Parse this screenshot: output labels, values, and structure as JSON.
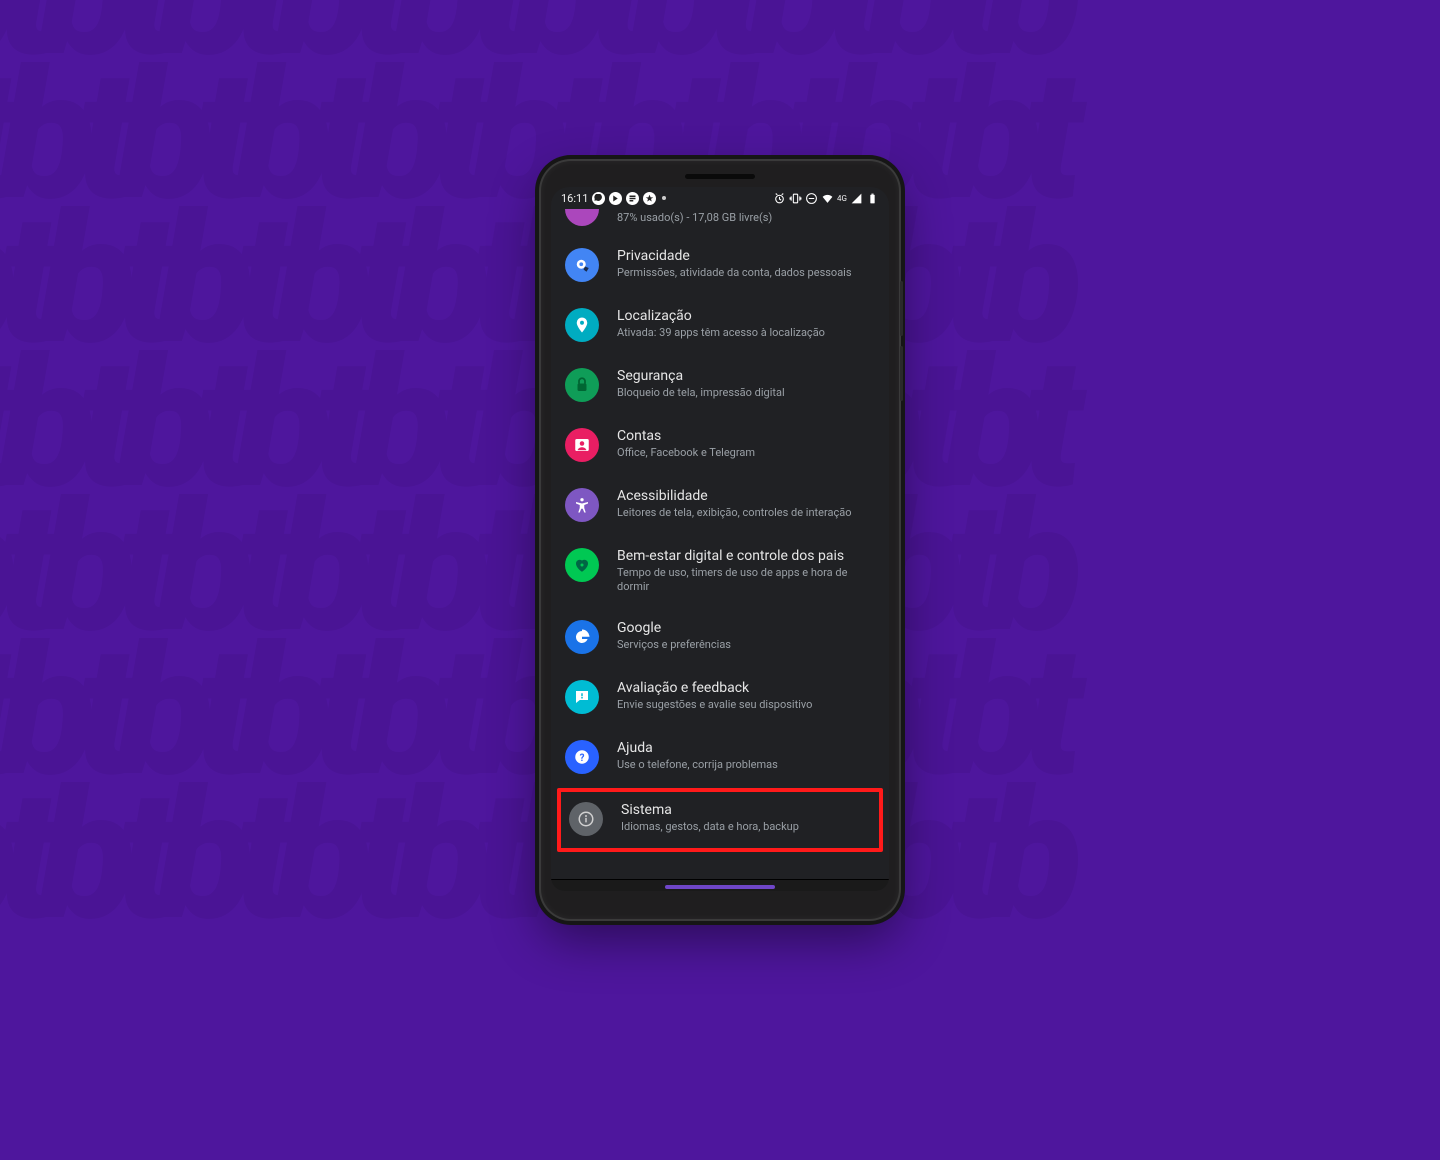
{
  "status": {
    "time": "16:11",
    "network_label": "4G"
  },
  "storage_stub": {
    "subtitle": "87% usado(s) - 17,08 GB livre(s)"
  },
  "items": [
    {
      "id": "privacy",
      "icon": "eye-shield",
      "color": "c-blue",
      "title": "Privacidade",
      "subtitle": "Permissões, atividade da conta, dados pessoais",
      "highlight": false
    },
    {
      "id": "location",
      "icon": "pin",
      "color": "c-teal",
      "title": "Localização",
      "subtitle": "Ativada: 39 apps têm acesso à localização",
      "highlight": false
    },
    {
      "id": "security",
      "icon": "lock",
      "color": "c-green",
      "title": "Segurança",
      "subtitle": "Bloqueio de tela, impressão digital",
      "highlight": false
    },
    {
      "id": "accounts",
      "icon": "user",
      "color": "c-pink",
      "title": "Contas",
      "subtitle": "Office, Facebook e Telegram",
      "highlight": false
    },
    {
      "id": "accessibility",
      "icon": "a11y",
      "color": "c-purple",
      "title": "Acessibilidade",
      "subtitle": "Leitores de tela, exibição, controles de interação",
      "highlight": false
    },
    {
      "id": "wellbeing",
      "icon": "heart",
      "color": "c-mint",
      "title": "Bem-estar digital e controle dos pais",
      "subtitle": "Tempo de uso, timers de uso de apps e hora de dormir",
      "highlight": false
    },
    {
      "id": "google",
      "icon": "g",
      "color": "c-gblue",
      "title": "Google",
      "subtitle": "Serviços e preferências",
      "highlight": false
    },
    {
      "id": "feedback",
      "icon": "chat",
      "color": "c-cyan",
      "title": "Avaliação e feedback",
      "subtitle": "Envie sugestões e avalie seu dispositivo",
      "highlight": false
    },
    {
      "id": "help",
      "icon": "question",
      "color": "c-royal",
      "title": "Ajuda",
      "subtitle": "Use o telefone, corrija problemas",
      "highlight": false
    },
    {
      "id": "system",
      "icon": "info",
      "color": "c-grey",
      "title": "Sistema",
      "subtitle": "Idiomas, gestos, data e hora, backup",
      "highlight": true
    }
  ]
}
